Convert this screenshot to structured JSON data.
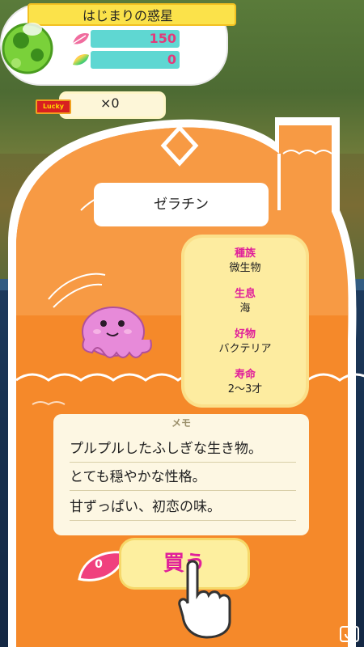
{
  "header": {
    "planet_name": "はじまりの惑星",
    "leaf_count": "150",
    "rainbow_count": "0"
  },
  "lucky": {
    "tag": "Lucky",
    "count": "×0"
  },
  "creature": {
    "name": "ゼラチン",
    "info": [
      {
        "label": "種族",
        "value": "微生物"
      },
      {
        "label": "生息",
        "value": "海"
      },
      {
        "label": "好物",
        "value": "バクテリア"
      },
      {
        "label": "寿命",
        "value": "2〜3才"
      }
    ]
  },
  "memo": {
    "title": "メモ",
    "lines": [
      "プルプルしたふしぎな生き物。",
      "とても穏やかな性格。",
      "甘ずっぱい、初恋の味。"
    ]
  },
  "buy": {
    "label": "買う",
    "price": "0"
  },
  "colors": {
    "house_orange": "#f5892a",
    "house_light": "#f7a04a",
    "highlight_pink": "#e0209a",
    "creature_pink": "#e78ad9"
  }
}
